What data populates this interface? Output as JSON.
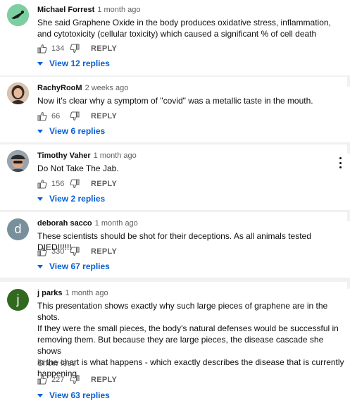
{
  "comments": [
    {
      "author": "Michael Forrest",
      "time": "1 month ago",
      "text": "She said Graphene Oxide in the body produces oxidative stress, inflammation, and cytotoxicity (cellular toxicity) which caused a significant % of cell death",
      "likes": "134",
      "reply_label": "REPLY",
      "view_replies": "View 12 replies",
      "avatar_icon": "bird-avatar-icon",
      "avatar_color": "#6fbf8a"
    },
    {
      "author": "RachyRooM",
      "time": "2 weeks ago",
      "text": "Now it's clear why a symptom of \"covid\" was a metallic taste in the mouth.",
      "likes": "66",
      "reply_label": "REPLY",
      "view_replies": "View 6 replies",
      "avatar_icon": "woman-portrait-avatar-icon",
      "avatar_color": "#b98a6a"
    },
    {
      "author": "Timothy Vaher",
      "time": "1 month ago",
      "text": "Do Not Take The Jab.",
      "likes": "156",
      "reply_label": "REPLY",
      "view_replies": "View 2 replies",
      "avatar_icon": "man-with-cap-avatar-icon",
      "avatar_color": "#8a8f96"
    },
    {
      "author": "deborah sacco",
      "time": "1 month ago",
      "text": "These scientists should be shot for their deceptions. As all animals tested DIED!!!!!!",
      "likes": "330",
      "reply_label": "REPLY",
      "view_replies": "View 67 replies",
      "avatar_letter": "d",
      "avatar_color": "#78909c"
    },
    {
      "author": "j parks",
      "time": "1 month ago",
      "text_lines": [
        "This presentation shows exactly why such large pieces of graphene are in the shots.",
        "If they were the small pieces, the body's natural defenses would be successful in",
        "removing them.  But because they are large pieces, the disease cascade she shows",
        "in the chart is what happens - which exactly describes the disease that is currently",
        "happening."
      ],
      "show_less": "Show less",
      "likes": "227",
      "reply_label": "REPLY",
      "view_replies": "View 63 replies",
      "avatar_letter": "j",
      "avatar_color": "#33691e"
    }
  ],
  "icons": {
    "like": "thumbs-up-icon",
    "dislike": "thumbs-down-icon",
    "menu": "more-vert-icon",
    "expand": "expand-triangle-icon"
  },
  "colors": {
    "link": "#065fd4",
    "secondary_text": "#606060",
    "separator": "#f1f1f1"
  }
}
